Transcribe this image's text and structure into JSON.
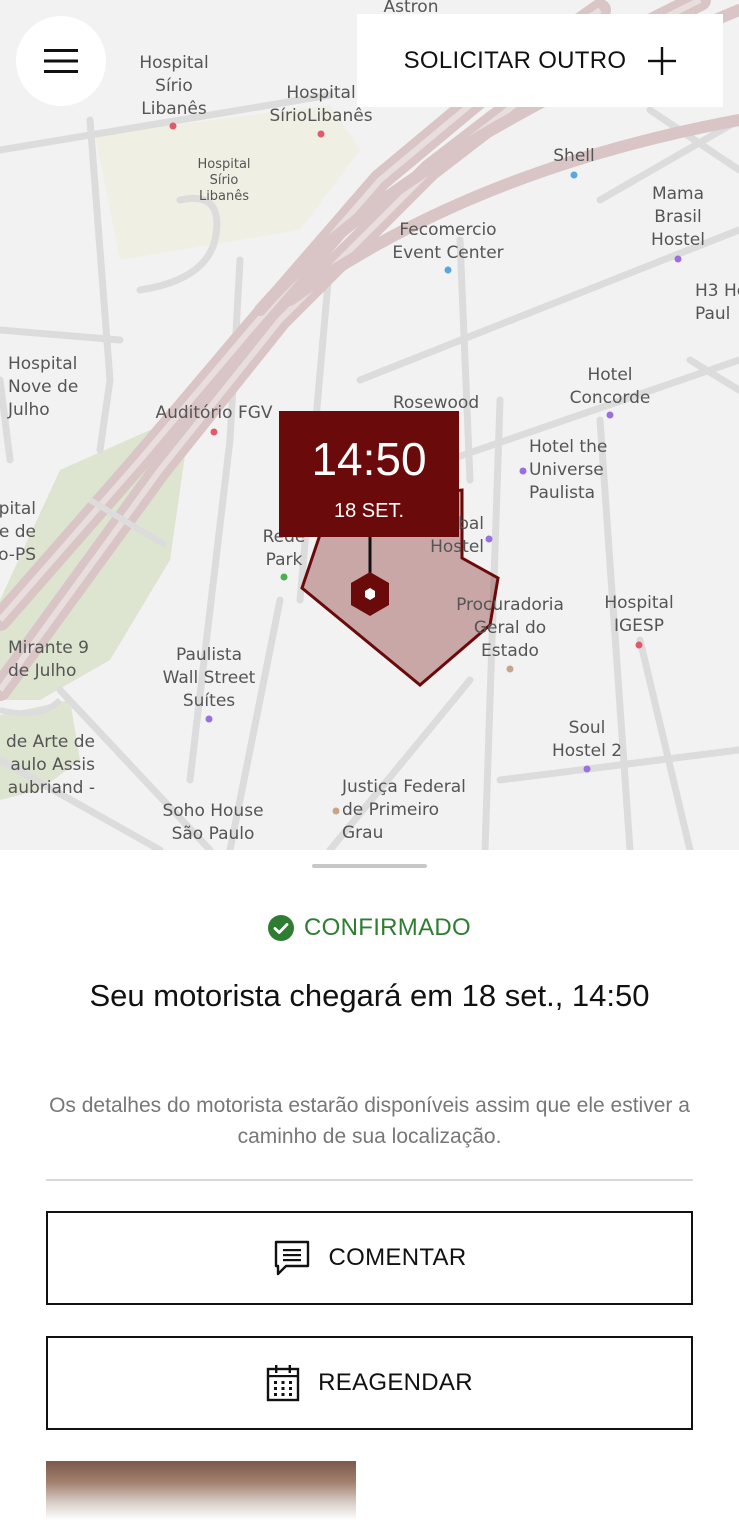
{
  "map": {
    "menu_icon": "hamburger-icon",
    "request_button": {
      "label": "SOLICITAR OUTRO",
      "icon": "plus-icon"
    },
    "pin": {
      "time": "14:50",
      "date": "18 SET.",
      "color": "#6b0a0a"
    },
    "labels": {
      "astron": "Astron",
      "sirio1": "Hospital\nSírio\nLibanês",
      "sirio2": "Hospital\nSírioLibanês",
      "sirio3": "Hospital\nSírio\nLibanês",
      "shell": "Shell",
      "mama": "Mama\nBrasil\nHostel",
      "fecomercio": "Fecomercio\nEvent Center",
      "h3": "H3 Ho\nPaul",
      "nove_julho": "Hospital\nNove de\nJulho",
      "auditorio": "Auditório FGV",
      "rosewood": "Rosewood\nlo",
      "concorde": "Hotel\nConcorde",
      "universe": "Hotel the\nUniverse\nPaulista",
      "bal_hostel": "bal\nHostel",
      "spital": "pital\ne de\no-PS",
      "rede_park": "Rede\nPark",
      "procuradoria": "Procuradoria\nGeral do\nEstado",
      "igesp": "Hospital\nIGESP",
      "mirante": "Mirante 9\nde Julho",
      "wall_street": "Paulista\nWall Street\nSuítes",
      "arte": "de Arte de\naulo Assis\naubriand -",
      "soul": "Soul\nHostel 2",
      "justica": "Justiça Federal\nde Primeiro\nGrau",
      "soho": "Soho House\nSão Paulo"
    }
  },
  "sheet": {
    "status": {
      "icon": "check-circle-icon",
      "label": "CONFIRMADO",
      "color": "#2e7d32"
    },
    "heading": "Seu motorista chegará em 18 set., 14:50",
    "description": "Os detalhes do motorista estarão disponíveis assim que ele estiver a caminho de sua localização.",
    "comment_button": {
      "label": "COMENTAR",
      "icon": "chat-icon"
    },
    "reschedule_button": {
      "label": "REAGENDAR",
      "icon": "calendar-icon"
    }
  }
}
